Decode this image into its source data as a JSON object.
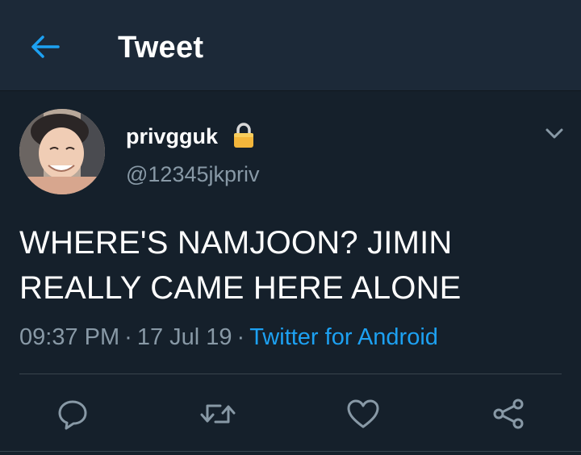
{
  "header": {
    "back_icon": "arrow-left-icon",
    "title": "Tweet",
    "accent_color": "#1da1f2",
    "background_color": "#1c2938"
  },
  "tweet": {
    "display_name": "privgguk",
    "protected_icon": "lock-icon",
    "handle": "@12345jkpriv",
    "menu_icon": "chevron-down-icon",
    "text": "WHERE'S NAMJOON? JIMIN REALLY CAME HERE ALONE",
    "time": "09:37 PM",
    "date": "17 Jul 19",
    "separator": "·",
    "source": "Twitter for Android",
    "background_color": "#15202b"
  },
  "actions": [
    {
      "name": "reply",
      "icon": "reply-icon"
    },
    {
      "name": "retweet",
      "icon": "retweet-icon"
    },
    {
      "name": "like",
      "icon": "heart-icon"
    },
    {
      "name": "share",
      "icon": "share-icon"
    }
  ]
}
